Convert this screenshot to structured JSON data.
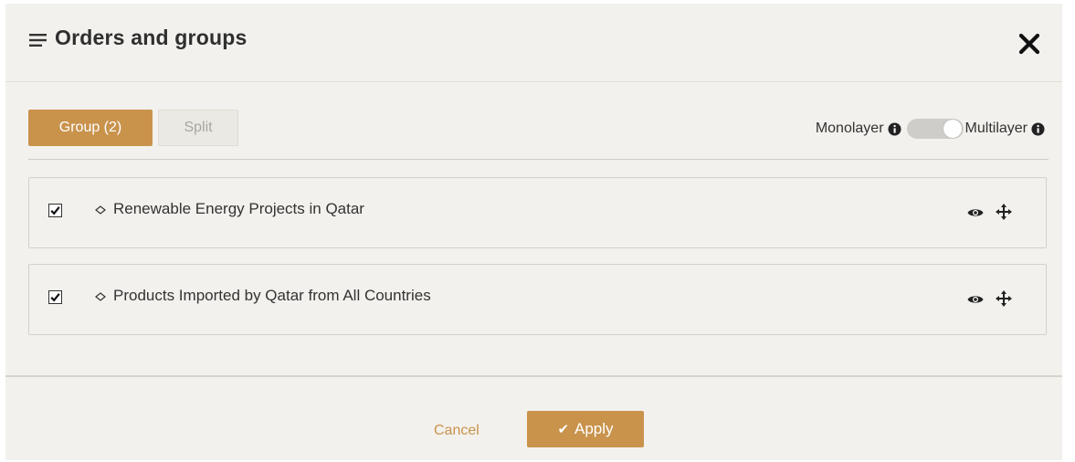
{
  "dialog": {
    "title": "Orders and groups",
    "menu_icon": "menu-lines-icon",
    "close_icon": "close-x-icon"
  },
  "toolbar": {
    "group_label": "Group (2)",
    "split_label": "Split",
    "monolayer_label": "Monolayer",
    "multilayer_label": "Multilayer",
    "toggle_state": "multilayer",
    "info_icon": "info-circle-icon"
  },
  "layers": [
    {
      "checked": true,
      "label": "Renewable Energy Projects in Qatar",
      "type_icon": "diamond-outline-icon",
      "visibility_icon": "eye-icon",
      "move_icon": "move-arrows-icon"
    },
    {
      "checked": true,
      "label": "Products Imported by Qatar from All Countries",
      "type_icon": "diamond-outline-icon",
      "visibility_icon": "eye-icon",
      "move_icon": "move-arrows-icon"
    }
  ],
  "footer": {
    "cancel_label": "Cancel",
    "apply_label": "Apply",
    "apply_icon": "checkmark-icon"
  },
  "colors": {
    "accent": "#c9934c",
    "background": "#f3f1ed",
    "border": "#d4d1cb"
  }
}
